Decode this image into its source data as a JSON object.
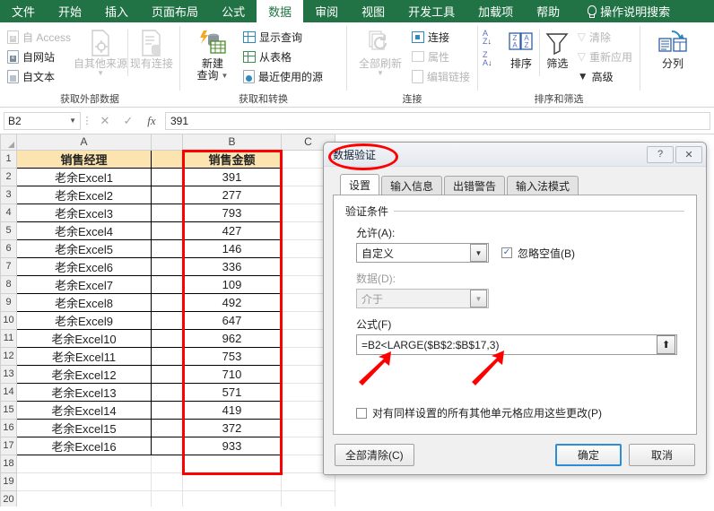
{
  "ribbon": {
    "tabs": [
      {
        "label": "文件",
        "active": false
      },
      {
        "label": "开始",
        "active": false
      },
      {
        "label": "插入",
        "active": false
      },
      {
        "label": "页面布局",
        "active": false
      },
      {
        "label": "公式",
        "active": false
      },
      {
        "label": "数据",
        "active": true
      },
      {
        "label": "审阅",
        "active": false
      },
      {
        "label": "视图",
        "active": false
      },
      {
        "label": "开发工具",
        "active": false
      },
      {
        "label": "加载项",
        "active": false
      },
      {
        "label": "帮助",
        "active": false
      }
    ],
    "tell_me": "操作说明搜索",
    "lamp_icon": "lightbulb-icon",
    "groups": [
      {
        "caption": "获取外部数据",
        "small": [
          {
            "label": "自 Access",
            "icon": "access-doc-icon",
            "tag": "A",
            "disabled": true
          },
          {
            "label": "自网站",
            "icon": "web-doc-icon",
            "tag": "e",
            "disabled": false
          },
          {
            "label": "自文本",
            "icon": "text-doc-icon",
            "tag": "",
            "disabled": false
          }
        ],
        "big": [
          {
            "label1": "自其他来源",
            "label2": "",
            "icon": "other-sources-icon",
            "caret": true,
            "disabled": true
          },
          {
            "label1": "现有连接",
            "label2": "",
            "icon": "existing-connections-icon",
            "caret": false,
            "disabled": true
          }
        ]
      },
      {
        "caption": "获取和转换",
        "big": [
          {
            "label1": "新建",
            "label2": "查询",
            "icon": "new-query-icon",
            "caret": true,
            "disabled": false
          }
        ],
        "small": [
          {
            "label": "显示查询",
            "icon": "show-queries-icon",
            "disabled": false
          },
          {
            "label": "从表格",
            "icon": "from-table-icon",
            "disabled": false
          },
          {
            "label": "最近使用的源",
            "icon": "recent-sources-icon",
            "disabled": false
          }
        ]
      },
      {
        "caption": "连接",
        "big": [
          {
            "label1": "全部刷新",
            "label2": "",
            "icon": "refresh-all-icon",
            "caret": true,
            "disabled": true
          }
        ],
        "small": [
          {
            "label": "连接",
            "icon": "connections-icon",
            "disabled": false
          },
          {
            "label": "属性",
            "icon": "properties-icon",
            "disabled": true
          },
          {
            "label": "编辑链接",
            "icon": "edit-links-icon",
            "disabled": true
          }
        ]
      },
      {
        "caption": "排序和筛选",
        "sort_az": "sort-ascending-icon",
        "sort_za": "sort-descending-icon",
        "big": [
          {
            "label1": "排序",
            "label2": "",
            "icon": "sort-icon",
            "caret": false,
            "disabled": false
          },
          {
            "label1": "筛选",
            "label2": "",
            "icon": "filter-icon",
            "caret": false,
            "disabled": false
          }
        ],
        "small": [
          {
            "label": "清除",
            "icon": "clear-filter-icon",
            "disabled": true
          },
          {
            "label": "重新应用",
            "icon": "reapply-icon",
            "disabled": true
          },
          {
            "label": "高级",
            "icon": "advanced-filter-icon",
            "disabled": false
          }
        ]
      },
      {
        "caption": "",
        "big": [
          {
            "label1": "分列",
            "label2": "",
            "icon": "text-to-columns-icon",
            "caret": false,
            "disabled": false
          }
        ]
      }
    ]
  },
  "formula_bar": {
    "name_box": "B2",
    "cancel_icon": "cancel-icon",
    "confirm_icon": "confirm-icon",
    "fx_icon": "fx-icon",
    "value": "391"
  },
  "sheet": {
    "column_headers": [
      "A",
      "B",
      "C"
    ],
    "header_row": {
      "a": "销售经理",
      "b": "销售金额"
    },
    "rows": [
      {
        "n": "2",
        "a": "老余Excel1",
        "b": "391"
      },
      {
        "n": "3",
        "a": "老余Excel2",
        "b": "277"
      },
      {
        "n": "4",
        "a": "老余Excel3",
        "b": "793"
      },
      {
        "n": "5",
        "a": "老余Excel4",
        "b": "427"
      },
      {
        "n": "6",
        "a": "老余Excel5",
        "b": "146"
      },
      {
        "n": "7",
        "a": "老余Excel6",
        "b": "336"
      },
      {
        "n": "8",
        "a": "老余Excel7",
        "b": "109"
      },
      {
        "n": "9",
        "a": "老余Excel8",
        "b": "492"
      },
      {
        "n": "10",
        "a": "老余Excel9",
        "b": "647"
      },
      {
        "n": "11",
        "a": "老余Excel10",
        "b": "962"
      },
      {
        "n": "12",
        "a": "老余Excel11",
        "b": "753"
      },
      {
        "n": "13",
        "a": "老余Excel12",
        "b": "710"
      },
      {
        "n": "14",
        "a": "老余Excel13",
        "b": "571"
      },
      {
        "n": "15",
        "a": "老余Excel14",
        "b": "419"
      },
      {
        "n": "16",
        "a": "老余Excel15",
        "b": "372"
      },
      {
        "n": "17",
        "a": "老余Excel16",
        "b": "933"
      }
    ],
    "trailing_row_numbers": [
      "18",
      "19",
      "20"
    ],
    "header_fill": "#FCE4B0"
  },
  "dialog": {
    "title": "数据验证",
    "help_icon": "help-icon",
    "close_icon": "close-icon",
    "tabs": [
      {
        "label": "设置",
        "active": true
      },
      {
        "label": "输入信息",
        "active": false
      },
      {
        "label": "出错警告",
        "active": false
      },
      {
        "label": "输入法模式",
        "active": false
      }
    ],
    "legend": "验证条件",
    "allow_label": "允许(A):",
    "allow_value": "自定义",
    "ignore_blank_label": "忽略空值(B)",
    "ignore_blank_checked": true,
    "data_label": "数据(D):",
    "data_value": "介于",
    "formula_label": "公式(F)",
    "formula_value": "=B2<LARGE($B$2:$B$17,3)",
    "range_picker_icon": "range-select-icon",
    "apply_all_label": "对有同样设置的所有其他单元格应用这些更改(P)",
    "apply_all_checked": false,
    "clear_all_button": "全部清除(C)",
    "ok_button": "确定",
    "cancel_button": "取消"
  },
  "annotations": {
    "accent_color": "#ff0000",
    "ellipse_target": "数据验证",
    "rect_target": "销售金额",
    "arrow_count": 2
  }
}
